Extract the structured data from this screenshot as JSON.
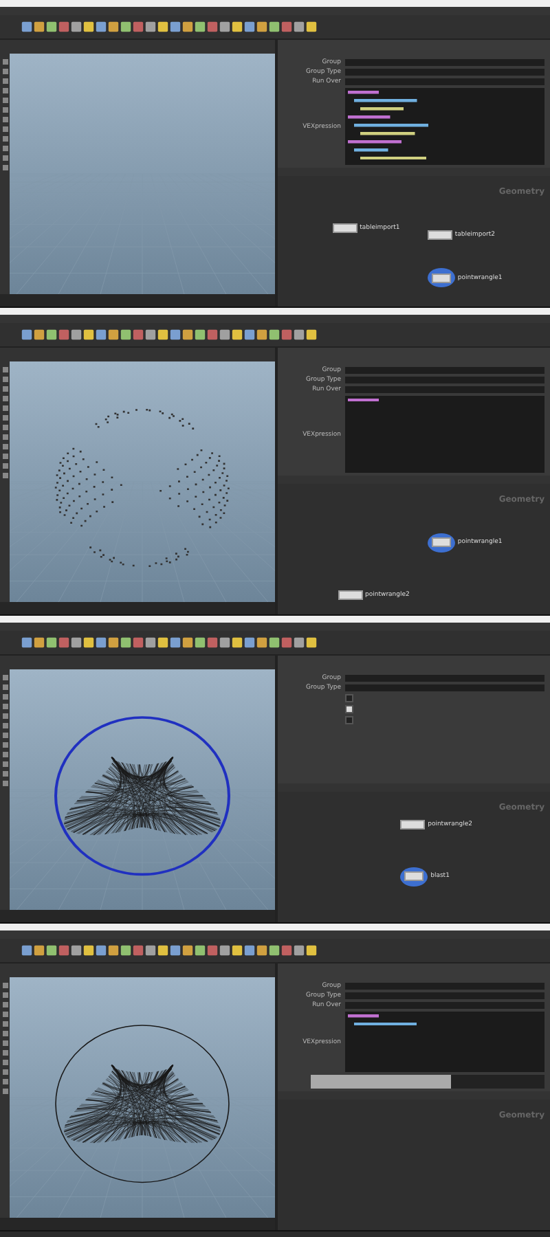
{
  "panels": [
    {
      "viewport": {
        "kind": "empty"
      },
      "params": [
        {
          "kind": "field",
          "label": "Group"
        },
        {
          "kind": "field",
          "label": "Group Type"
        },
        {
          "kind": "field",
          "label": "Run Over"
        },
        {
          "kind": "code",
          "label": "VEXpression"
        }
      ],
      "network": {
        "label": "Geometry",
        "nodes": [
          {
            "name": "tableimport1",
            "display": false
          },
          {
            "name": "tableimport2",
            "display": false
          },
          {
            "name": "pointwrangle1",
            "display": true
          }
        ]
      }
    },
    {
      "viewport": {
        "kind": "points"
      },
      "params": [
        {
          "kind": "field",
          "label": "Group"
        },
        {
          "kind": "field",
          "label": "Group Type"
        },
        {
          "kind": "field",
          "label": "Run Over"
        },
        {
          "kind": "code",
          "label": "VEXpression"
        }
      ],
      "network": {
        "label": "Geometry",
        "nodes": [
          {
            "name": "pointwrangle1",
            "display": true
          },
          {
            "name": "pointwrangle2",
            "display": false
          }
        ]
      }
    },
    {
      "viewport": {
        "kind": "wire-blue"
      },
      "params": [
        {
          "kind": "field",
          "label": "Group"
        },
        {
          "kind": "field",
          "label": "Group Type"
        },
        {
          "kind": "checkbox",
          "checked": false
        },
        {
          "kind": "checkbox",
          "checked": true
        },
        {
          "kind": "checkbox",
          "checked": false
        }
      ],
      "network": {
        "label": "Geometry",
        "nodes": [
          {
            "name": "pointwrangle2",
            "display": false
          },
          {
            "name": "blast1",
            "display": true
          }
        ]
      }
    },
    {
      "viewport": {
        "kind": "wire"
      },
      "params": [
        {
          "kind": "field",
          "label": "Group"
        },
        {
          "kind": "field",
          "label": "Group Type"
        },
        {
          "kind": "field",
          "label": "Run Over"
        },
        {
          "kind": "code",
          "label": "VEXpression"
        },
        {
          "kind": "ramp",
          "level": 0.6
        }
      ],
      "network": {
        "label": "Geometry"
      }
    }
  ]
}
